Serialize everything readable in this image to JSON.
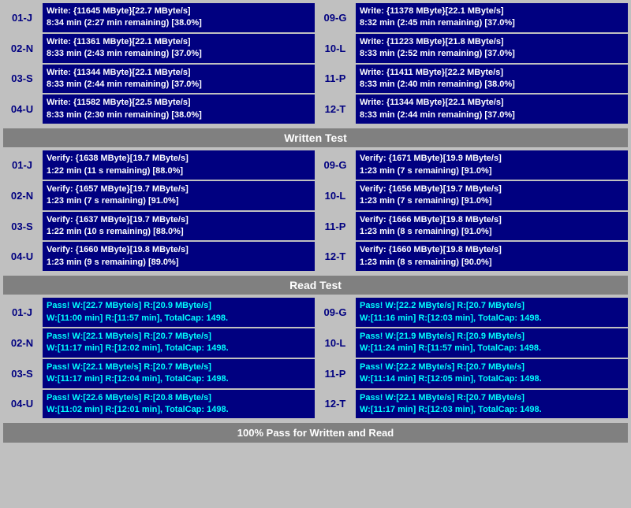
{
  "written_test": {
    "header": "Written Test",
    "left": [
      {
        "id": "01-J",
        "line1": "Write: {11645 MByte}[22.7 MByte/s]",
        "line2": "8:34 min (2:27 min remaining)  [38.0%]"
      },
      {
        "id": "02-N",
        "line1": "Write: {11361 MByte}[22.1 MByte/s]",
        "line2": "8:33 min (2:43 min remaining)  [37.0%]"
      },
      {
        "id": "03-S",
        "line1": "Write: {11344 MByte}[22.1 MByte/s]",
        "line2": "8:33 min (2:44 min remaining)  [37.0%]"
      },
      {
        "id": "04-U",
        "line1": "Write: {11582 MByte}[22.5 MByte/s]",
        "line2": "8:33 min (2:30 min remaining)  [38.0%]"
      }
    ],
    "right": [
      {
        "id": "09-G",
        "line1": "Write: {11378 MByte}[22.1 MByte/s]",
        "line2": "8:32 min (2:45 min remaining)  [37.0%]"
      },
      {
        "id": "10-L",
        "line1": "Write: {11223 MByte}[21.8 MByte/s]",
        "line2": "8:33 min (2:52 min remaining)  [37.0%]"
      },
      {
        "id": "11-P",
        "line1": "Write: {11411 MByte}[22.2 MByte/s]",
        "line2": "8:33 min (2:40 min remaining)  [38.0%]"
      },
      {
        "id": "12-T",
        "line1": "Write: {11344 MByte}[22.1 MByte/s]",
        "line2": "8:33 min (2:44 min remaining)  [37.0%]"
      }
    ]
  },
  "verify_test": {
    "left": [
      {
        "id": "01-J",
        "line1": "Verify: {1638 MByte}[19.7 MByte/s]",
        "line2": "1:22 min (11 s remaining)   [88.0%]"
      },
      {
        "id": "02-N",
        "line1": "Verify: {1657 MByte}[19.7 MByte/s]",
        "line2": "1:23 min (7 s remaining)   [91.0%]"
      },
      {
        "id": "03-S",
        "line1": "Verify: {1637 MByte}[19.7 MByte/s]",
        "line2": "1:22 min (10 s remaining)   [88.0%]"
      },
      {
        "id": "04-U",
        "line1": "Verify: {1660 MByte}[19.8 MByte/s]",
        "line2": "1:23 min (9 s remaining)   [89.0%]"
      }
    ],
    "right": [
      {
        "id": "09-G",
        "line1": "Verify: {1671 MByte}[19.9 MByte/s]",
        "line2": "1:23 min (7 s remaining)   [91.0%]"
      },
      {
        "id": "10-L",
        "line1": "Verify: {1656 MByte}[19.7 MByte/s]",
        "line2": "1:23 min (7 s remaining)   [91.0%]"
      },
      {
        "id": "11-P",
        "line1": "Verify: {1666 MByte}[19.8 MByte/s]",
        "line2": "1:23 min (8 s remaining)   [91.0%]"
      },
      {
        "id": "12-T",
        "line1": "Verify: {1660 MByte}[19.8 MByte/s]",
        "line2": "1:23 min (8 s remaining)   [90.0%]"
      }
    ]
  },
  "read_test": {
    "header": "Read Test",
    "left": [
      {
        "id": "01-J",
        "line1": "Pass! W:[22.7 MByte/s] R:[20.9 MByte/s]",
        "line2": "W:[11:00 min] R:[11:57 min], TotalCap: 1498."
      },
      {
        "id": "02-N",
        "line1": "Pass! W:[22.1 MByte/s] R:[20.7 MByte/s]",
        "line2": "W:[11:17 min] R:[12:02 min], TotalCap: 1498."
      },
      {
        "id": "03-S",
        "line1": "Pass! W:[22.1 MByte/s] R:[20.7 MByte/s]",
        "line2": "W:[11:17 min] R:[12:04 min], TotalCap: 1498."
      },
      {
        "id": "04-U",
        "line1": "Pass! W:[22.6 MByte/s] R:[20.8 MByte/s]",
        "line2": "W:[11:02 min] R:[12:01 min], TotalCap: 1498."
      }
    ],
    "right": [
      {
        "id": "09-G",
        "line1": "Pass! W:[22.2 MByte/s] R:[20.7 MByte/s]",
        "line2": "W:[11:16 min] R:[12:03 min], TotalCap: 1498."
      },
      {
        "id": "10-L",
        "line1": "Pass! W:[21.9 MByte/s] R:[20.9 MByte/s]",
        "line2": "W:[11:24 min] R:[11:57 min], TotalCap: 1498."
      },
      {
        "id": "11-P",
        "line1": "Pass! W:[22.2 MByte/s] R:[20.7 MByte/s]",
        "line2": "W:[11:14 min] R:[12:05 min], TotalCap: 1498."
      },
      {
        "id": "12-T",
        "line1": "Pass! W:[22.1 MByte/s] R:[20.7 MByte/s]",
        "line2": "W:[11:17 min] R:[12:03 min], TotalCap: 1498."
      }
    ]
  },
  "status": "100% Pass for Written and Read"
}
